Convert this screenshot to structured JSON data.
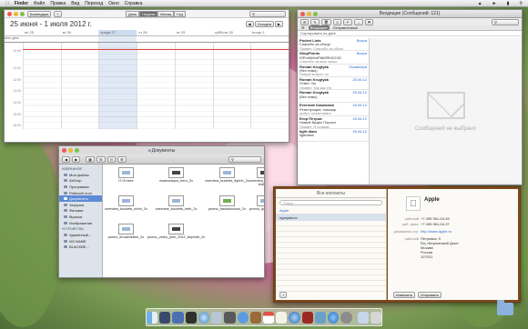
{
  "menubar": {
    "app": "Finder",
    "items": [
      "Файл",
      "Правка",
      "Вид",
      "Переход",
      "Окно",
      "Справка"
    ]
  },
  "calendar": {
    "toolbar": {
      "calendars_btn": "Календари",
      "day": "День",
      "week": "Неделя",
      "month": "Месяц",
      "year": "Год"
    },
    "range_title": "25 июня - 1 июля 2012 г.",
    "today_btn": "Сегодня",
    "days": [
      "пн 25",
      "вт 26",
      "среда 27",
      "чт 28",
      "пт 29",
      "суббота 30",
      "воскр 1"
    ],
    "allday": "весь день",
    "hours": [
      "",
      "10:00",
      "",
      "",
      "11:00",
      "",
      "12:00",
      "",
      "13:00",
      "",
      "14:00",
      "",
      "15:00",
      "",
      "16:00"
    ]
  },
  "mail": {
    "title": "Входящие (Сообщений: 121)",
    "tabs": [
      "Входящие",
      "Отправленные"
    ],
    "selected_tab": "Входящие",
    "sort": "Сортировать по дате",
    "no_message": "Сообщений не выбрано",
    "messages": [
      {
        "from": "Pocket Lists",
        "date": "Вчера",
        "subject": "Спасибо за обзор!",
        "preview": "Привет, Спасибо за обзор"
      },
      {
        "from": "ShopPoints",
        "date": "Вчера",
        "subject": "tSProfile!lolPAIl6RK0OXD.",
        "preview": "Спасибо за ваш заказ"
      },
      {
        "from": "Roman Krugtyak",
        "date": "Позавчера",
        "subject": "(без темы)",
        "preview": "Новый вопрос по"
      },
      {
        "from": "Roman Krugtyak",
        "date": "26.06.12",
        "subject": "Ответ: No",
        "preview": "Привет, Так как это"
      },
      {
        "from": "Roman Krugtyak",
        "date": "26.06.12",
        "subject": "(без темы)",
        "preview": ""
      },
      {
        "from": "Evernote Компания",
        "date": "26.06.12",
        "subject": "Регистрация, помощь",
        "preview": "Добро пожаловать"
      },
      {
        "from": "Егор Петров",
        "date": "26.06.12",
        "subject": "Новый Видео Портал",
        "preview": "Привет, Я создаю"
      },
      {
        "from": "light diam",
        "date": "26.06.12",
        "subject": "lightdiam",
        "preview": ""
      }
    ]
  },
  "finder": {
    "title": "Документы",
    "sidebar": [
      {
        "header": "ИЗБРАННОЕ",
        "items": [
          "Мои файлы",
          "AirDrop",
          "Программы",
          "Рабочий стол",
          "Документы",
          "Загрузки",
          "Фильмы",
          "Музыка",
          "Изображения"
        ]
      },
      {
        "header": "УСТРОЙСТВА",
        "items": [
          "Удалённый...",
          "NO NAME",
          "BLACKBE..."
        ]
      }
    ],
    "selected": "Документы",
    "files": [
      {
        "name": "О Отчете",
        "kind": "doc"
      },
      {
        "name": "macbookpro_hero_2x",
        "kind": "dark"
      },
      {
        "name": "overview_buckets_flyhhh_2x",
        "kind": "doc"
      },
      {
        "name": "overview_buckets_f tedh_2x",
        "kind": "dark"
      },
      {
        "name": "",
        "kind": "none"
      },
      {
        "name": "overview_buckets_nhhh_2x",
        "kind": "doc"
      },
      {
        "name": "overview_buckets_heth_2x",
        "kind": "doc"
      },
      {
        "name": "promo_backtoschool_2x",
        "kind": "grn"
      },
      {
        "name": "promo_ipadfreq_2x",
        "kind": "doc"
      },
      {
        "name": "",
        "kind": "none"
      },
      {
        "name": "promo_imusenetton_2x",
        "kind": "doc"
      },
      {
        "name": "promo_video_june_2012_keynote_2x",
        "kind": "dark"
      }
    ]
  },
  "contacts": {
    "header": "Все контакты",
    "search_placeholder": "Поиск",
    "group": "Apple",
    "contact": "ngoryainov",
    "add_btn": "+",
    "card": {
      "name": "Apple",
      "rows": [
        {
          "k": "рабочий",
          "v": "+7 495 961-04-39"
        },
        {
          "k": "раб. факс",
          "v": "+7 495 961-04-37"
        },
        {
          "k": "домашняя стр.",
          "v": "http://www.apple.ru"
        },
        {
          "k": "рабочий",
          "v": "Петровка, 5\nБЦ «Берлинский Дом»\nМосква\nРоссия\n107031"
        }
      ],
      "edit_btn": "Изменить",
      "share_btn": "Отправить"
    }
  },
  "colors": {
    "accent": "#5c8ad5",
    "now_line": "#e2413c",
    "mail_date": "#2d6bd1"
  }
}
